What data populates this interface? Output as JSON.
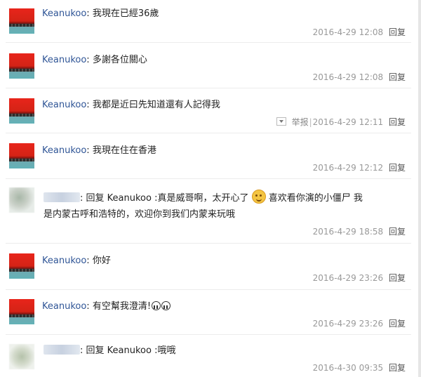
{
  "reply_label": "回复",
  "report_label": "举报",
  "comments": [
    {
      "user": "Keanukoo",
      "text": "我現在已經36歲",
      "time": "2016-4-29 12:08"
    },
    {
      "user": "Keanukoo",
      "text": "多謝各位關心",
      "time": "2016-4-29 12:08"
    },
    {
      "user": "Keanukoo",
      "text": "我都是近曰先知道還有人記得我",
      "time": "2016-4-29 12:11"
    },
    {
      "user": "Keanukoo",
      "text": "我現在住在香港",
      "time": "2016-4-29 12:12"
    },
    {
      "reply_prefix": ": 回复 Keanukoo :",
      "text_a": "真是威哥啊，太开心了",
      "text_b": "喜欢看你演的小僵尸 我",
      "text_c": "是内蒙古呼和浩特的，欢迎你到我们内蒙来玩哦",
      "time": "2016-4-29 18:58",
      "emoji": "smile-emoji"
    },
    {
      "user": "Keanukoo",
      "text": "你好",
      "time": "2016-4-29 23:26"
    },
    {
      "user": "Keanukoo",
      "text": "有空幫我澄清!",
      "time": "2016-4-29 23:26",
      "emoji": "crying-emoji"
    },
    {
      "reply_prefix": ": 回复 Keanukoo :",
      "text": "哦哦",
      "time": "2016-4-30 09:35"
    }
  ]
}
